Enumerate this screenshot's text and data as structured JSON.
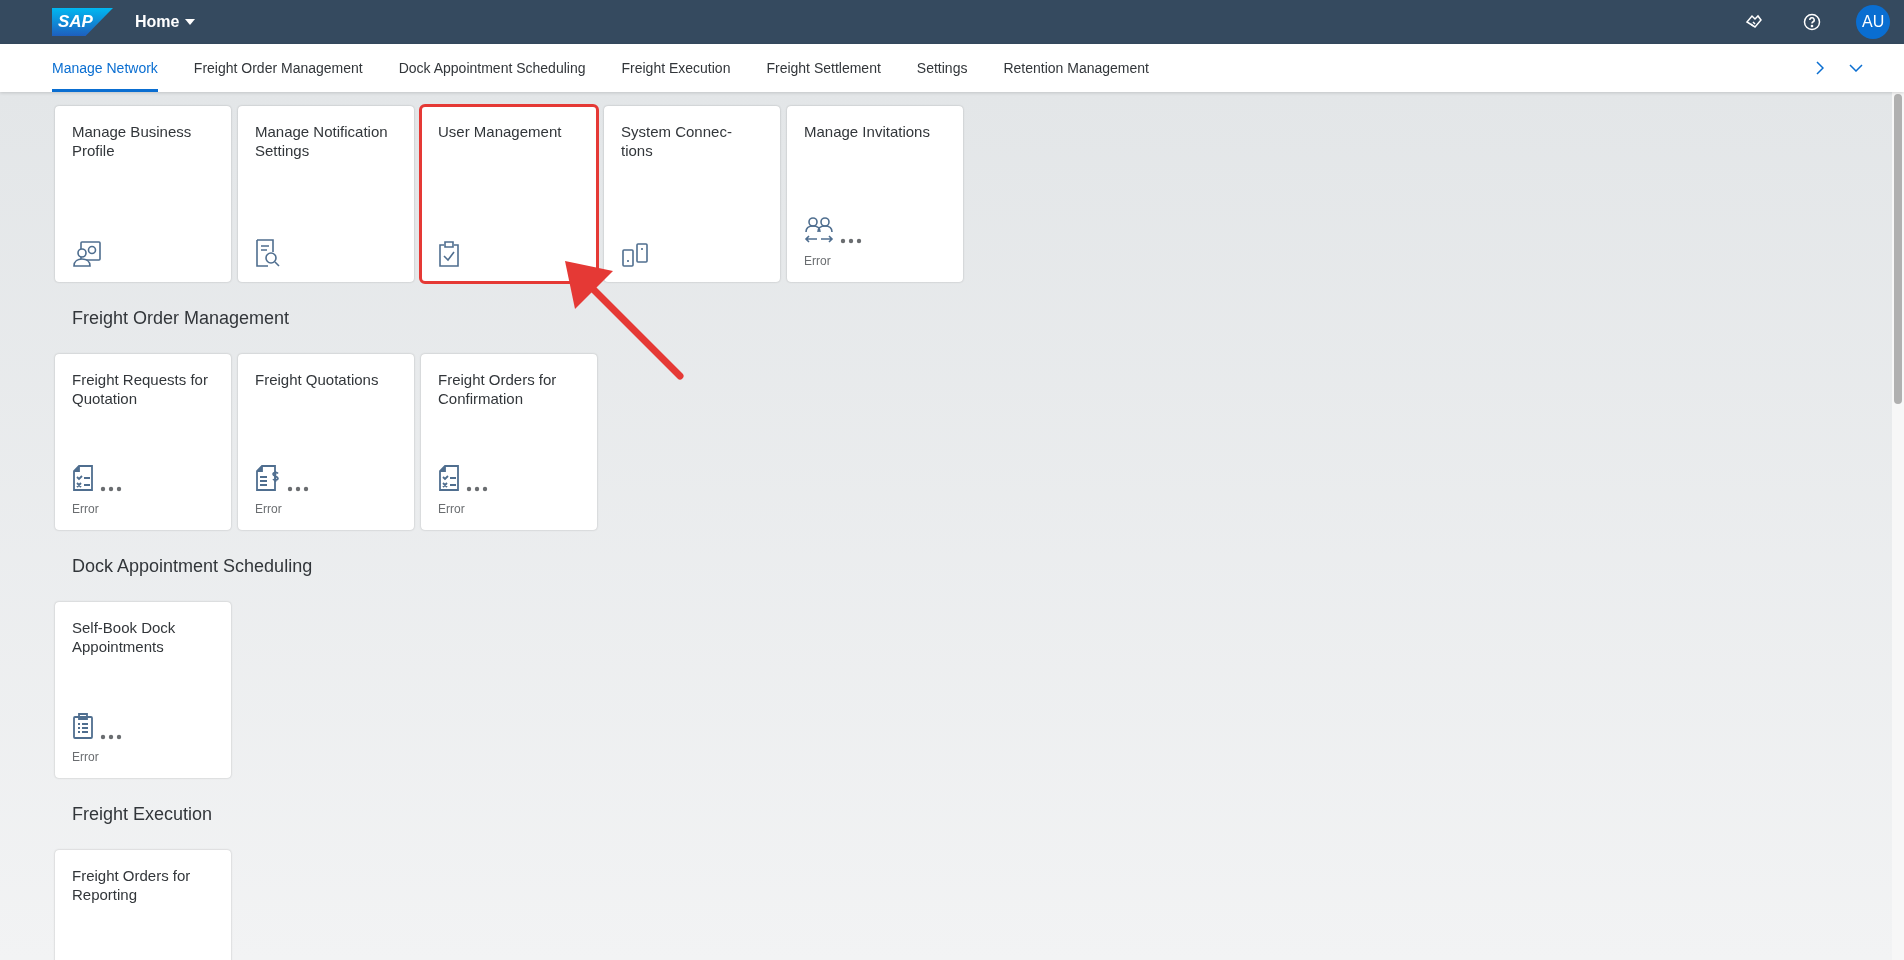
{
  "shell": {
    "logo": "SAP",
    "title": "Home",
    "avatar": "AU"
  },
  "tabs": [
    {
      "label": "Manage Network",
      "selected": true
    },
    {
      "label": "Freight Order Management",
      "selected": false
    },
    {
      "label": "Dock Appointment Scheduling",
      "selected": false
    },
    {
      "label": "Freight Execution",
      "selected": false
    },
    {
      "label": "Freight Settlement",
      "selected": false
    },
    {
      "label": "Settings",
      "selected": false
    },
    {
      "label": "Retention Management",
      "selected": false
    }
  ],
  "sections": [
    {
      "tiles": [
        {
          "title": "Manage Business Profile",
          "pending": false,
          "highlighted": false
        },
        {
          "title": "Manage Notification Settings",
          "pending": false,
          "highlighted": false
        },
        {
          "title": "User Management",
          "pending": false,
          "highlighted": true
        },
        {
          "title": "System Connec-tions",
          "pending": false,
          "highlighted": false
        },
        {
          "title": "Manage Invitations",
          "pending": true,
          "status": "Error",
          "highlighted": false
        }
      ]
    },
    {
      "title": "Freight Order Management",
      "tiles": [
        {
          "title": "Freight Requests for Quotation",
          "pending": true,
          "status": "Error",
          "highlighted": false
        },
        {
          "title": "Freight Quotations",
          "pending": true,
          "status": "Error",
          "highlighted": false
        },
        {
          "title": "Freight Orders for Confirmation",
          "pending": true,
          "status": "Error",
          "highlighted": false
        }
      ]
    },
    {
      "title": "Dock Appointment Scheduling",
      "tiles": [
        {
          "title": "Self-Book Dock Appointments",
          "pending": true,
          "status": "Error",
          "highlighted": false
        }
      ]
    },
    {
      "title": "Freight Execution",
      "tiles": [
        {
          "title": "Freight Orders for Reporting",
          "pending": false,
          "highlighted": false
        }
      ]
    }
  ]
}
